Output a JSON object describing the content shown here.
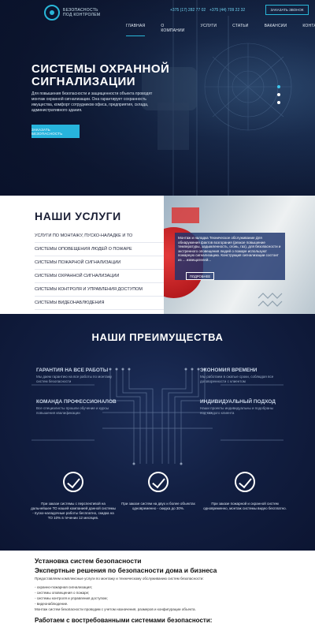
{
  "header": {
    "logo_line1": "БЕЗОПАСНОСТЬ",
    "logo_line2": "ПОД КОНТРОЛЕМ",
    "phone1": "+375 (17) 282 77 02",
    "phone2": "+375 (44) 709 22 32",
    "call_label": "ЗАКАЗАТЬ ЗВОНОК",
    "nav": [
      "ГЛАВНАЯ",
      "О КОМПАНИИ",
      "УСЛУГИ",
      "СТАТЬИ",
      "ВАКАНСИИ",
      "КОНТАКТЫ"
    ]
  },
  "hero": {
    "title_line1": "СИСТЕМЫ ОХРАННОЙ",
    "title_line2": "СИГНАЛИЗАЦИИ",
    "text": "Для повышения безопасности и защищенности объекта проводят монтаж охранной сигнализации. Она гарантирует сохранность имущества, комфорт сотрудников офиса, предприятия, склада, административного здания.",
    "button_label": "ЗАКАЗАТЬ БЕЗОПАСНОСТЬ",
    "slider_active": 1,
    "slider_count": 3
  },
  "services": {
    "title": "НАШИ УСЛУГИ",
    "items": [
      "УСЛУГИ ПО МОНТАЖУ, ПУСКО-НАЛАДКЕ И ТО",
      "СИСТЕМЫ ОПОВЕЩЕНИЯ ЛЮДЕЙ О ПОЖАРЕ",
      "СИСТЕМЫ ПОЖАРНОЙ СИГНАЛИЗАЦИИ",
      "СИСТЕМЫ ОХРАННОЙ СИГНАЛИЗАЦИИ",
      "СИСТЕМЫ КОНТРОЛЯ И УПРАВЛЕНИЯ ДОСТУПОМ",
      "СИСТЕМЫ ВИДЕОНАБЛЮДЕНИЯ"
    ],
    "panel_text": "Монтаж и наладка Техническое обслуживание Для обнаружения фактов возгорания (резкое повышение температуры, задымленность, огонь, газ), для безопасности и экстренного оповещения людей о пожаре используют пожарную сигнализацию. Конструкция сигнализации состоит из ... извещателей...",
    "more_label": "ПОДРОБНЕЕ"
  },
  "advantages": {
    "title": "НАШИ ПРЕИМУЩЕСТВА",
    "items": [
      {
        "title": "ГАРАНТИЯ НА ВСЕ РАБОТЫ",
        "text": "Мы даем гарантию на все работы по монтажу систем безопасности"
      },
      {
        "title": "ЭКОНОМИЯ ВРЕМЕНИ",
        "text": "Мы работаем в сжатые сроки, соблюдая все договоренности с клиентом"
      },
      {
        "title": "КОМАНДА ПРОФЕССИОНАЛОВ",
        "text": "Все специалисты прошли обучение и курсы повышения квалификации"
      },
      {
        "title": "ИНДИВИДУАЛЬНЫЙ ПОДХОД",
        "text": "Наши проекты индивидуальны и подобраны под каждого клиента"
      }
    ],
    "checks": [
      "При заказе системы с перспективой на дальнейшее ТО нашей компанией данной системы - пуско-наладочные работы бесплатно, скидка на ТО 10% в течении 12 месяцев.",
      "При заказе систем на двух и более объектах одновременно - скидка до 30%.",
      "При заказе пожарной и охранной систем одновременно, монтаж системы видео бесплатно."
    ]
  },
  "content": {
    "h1": "Установка систем безопасности",
    "h2": "Экспертные решения по безопасности дома и бизнеса",
    "intro": "Предоставляем комплексные услуги по монтажу и техническому обслуживанию систем безопасности:",
    "list": [
      "- охранно-пожарная сигнализация;",
      "- системы оповещения о пожаре;",
      "- системы контроля и управления доступом;",
      "- видеонаблюдение."
    ],
    "note": "Монтаж систем безопасности проводим с учетом назначения, размеров и конфигурации объекта.",
    "h3": "Работаем с востребованными системами безопасности:"
  }
}
